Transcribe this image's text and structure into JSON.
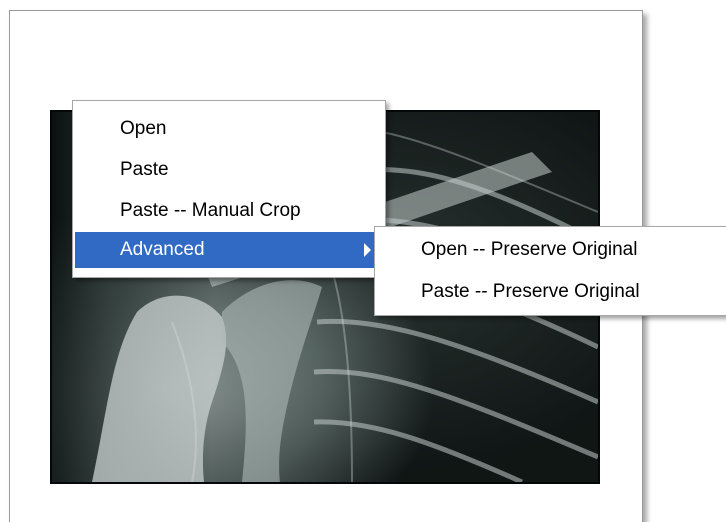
{
  "context_menu": {
    "items": [
      {
        "label": "Open"
      },
      {
        "label": "Paste"
      },
      {
        "label": "Paste -- Manual Crop"
      },
      {
        "label": "Advanced",
        "has_submenu": true,
        "highlighted": true
      }
    ]
  },
  "submenu": {
    "items": [
      {
        "label": "Open -- Preserve Original"
      },
      {
        "label": "Paste -- Preserve Original"
      }
    ]
  },
  "image": {
    "icon": "xray-shoulder-image"
  },
  "colors": {
    "highlight": "#316ac5",
    "highlight_text": "#ffffff",
    "menu_background": "#ffffff"
  }
}
